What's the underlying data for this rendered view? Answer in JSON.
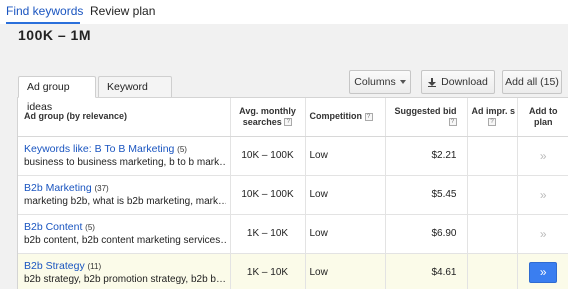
{
  "nav": {
    "tabs": [
      "Find keywords",
      "Review plan"
    ]
  },
  "metric": "100K – 1M",
  "subtabs": [
    "Ad group ideas",
    "Keyword ideas"
  ],
  "toolbar": {
    "columns": "Columns",
    "download": "Download",
    "add_all": "Add all (15)"
  },
  "table": {
    "headers": {
      "ad_group": "Ad group (by relevance)",
      "searches": "Avg. monthly searches",
      "competition": "Competition",
      "bid": "Suggested bid",
      "impr": "Ad impr. s",
      "add": "Add to plan"
    },
    "help_glyph": "?",
    "add_glyph": "»",
    "rows": [
      {
        "name": "Keywords like: B To B Marketing",
        "count": "(5)",
        "keywords": "business to business marketing, b to b mark…",
        "searches": "10K – 100K",
        "competition": "Low",
        "bid": "$2.21"
      },
      {
        "name": "B2b Marketing",
        "count": "(37)",
        "keywords": "marketing b2b, what is b2b marketing, mark…",
        "searches": "10K – 100K",
        "competition": "Low",
        "bid": "$5.45"
      },
      {
        "name": "B2b Content",
        "count": "(5)",
        "keywords": "b2b content, b2b content marketing services…",
        "searches": "1K – 10K",
        "competition": "Low",
        "bid": "$6.90"
      },
      {
        "name": "B2b Strategy",
        "count": "(11)",
        "keywords": "b2b strategy, b2b promotion strategy, b2b b…",
        "searches": "1K – 10K",
        "competition": "Low",
        "bid": "$4.61"
      }
    ]
  }
}
